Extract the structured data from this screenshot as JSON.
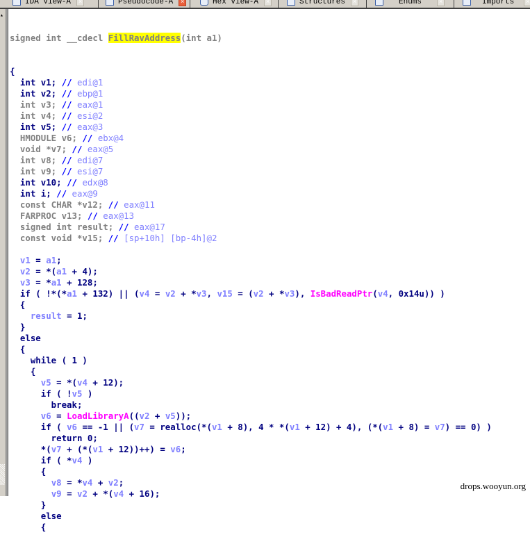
{
  "tabs": [
    {
      "label": "IDA View-A",
      "active": false
    },
    {
      "label": "Pseudocode-A",
      "active": true
    },
    {
      "label": "Hex View-A",
      "active": false
    },
    {
      "label": "Structures",
      "active": false
    },
    {
      "label": "Enums",
      "active": false
    },
    {
      "label": "Imports",
      "active": false
    }
  ],
  "code": {
    "signature": {
      "prefix": "signed int __cdecl ",
      "name": "FillRavAddress",
      "suffix": "(int a1)"
    },
    "lines": [
      [
        [
          "kw",
          "{"
        ]
      ],
      [
        [
          "kw",
          "  int v1; "
        ],
        [
          "cmk",
          "// "
        ],
        [
          "cm",
          "edi@1"
        ]
      ],
      [
        [
          "kw",
          "  int v2; "
        ],
        [
          "cmk",
          "// "
        ],
        [
          "cm",
          "ebp@1"
        ]
      ],
      [
        [
          "gray",
          "  int v3; "
        ],
        [
          "cmk",
          "// "
        ],
        [
          "cm",
          "eax@1"
        ]
      ],
      [
        [
          "gray",
          "  int v4; "
        ],
        [
          "cmk",
          "// "
        ],
        [
          "cm",
          "esi@2"
        ]
      ],
      [
        [
          "kw",
          "  int v5; "
        ],
        [
          "cmk",
          "// "
        ],
        [
          "cm",
          "eax@3"
        ]
      ],
      [
        [
          "gray",
          "  HMODULE v6; "
        ],
        [
          "cmk",
          "// "
        ],
        [
          "cm",
          "ebx@4"
        ]
      ],
      [
        [
          "gray",
          "  void *v7; "
        ],
        [
          "cmk",
          "// "
        ],
        [
          "cm",
          "eax@5"
        ]
      ],
      [
        [
          "gray",
          "  int v8; "
        ],
        [
          "cmk",
          "// "
        ],
        [
          "cm",
          "edi@7"
        ]
      ],
      [
        [
          "gray",
          "  int v9; "
        ],
        [
          "cmk",
          "// "
        ],
        [
          "cm",
          "esi@7"
        ]
      ],
      [
        [
          "kw",
          "  int v10; "
        ],
        [
          "cmk",
          "// "
        ],
        [
          "cm",
          "edx@8"
        ]
      ],
      [
        [
          "kw",
          "  int i; "
        ],
        [
          "cmk",
          "// "
        ],
        [
          "cm",
          "eax@9"
        ]
      ],
      [
        [
          "gray",
          "  const CHAR *v12; "
        ],
        [
          "cmk",
          "// "
        ],
        [
          "cm",
          "eax@11"
        ]
      ],
      [
        [
          "gray",
          "  FARPROC v13; "
        ],
        [
          "cmk",
          "// "
        ],
        [
          "cm",
          "eax@13"
        ]
      ],
      [
        [
          "gray",
          "  signed int result; "
        ],
        [
          "cmk",
          "// "
        ],
        [
          "cm",
          "eax@17"
        ]
      ],
      [
        [
          "gray",
          "  const void *v15; "
        ],
        [
          "cmk",
          "// "
        ],
        [
          "cm",
          "[sp+10h] [bp-4h]@2"
        ]
      ],
      [
        [
          "kw",
          ""
        ]
      ],
      [
        [
          "kw",
          "  "
        ],
        [
          "var",
          "v1"
        ],
        [
          "kw",
          " = "
        ],
        [
          "var",
          "a1"
        ],
        [
          "kw",
          ";"
        ]
      ],
      [
        [
          "kw",
          "  "
        ],
        [
          "var",
          "v2"
        ],
        [
          "kw",
          " = *("
        ],
        [
          "var",
          "a1"
        ],
        [
          "kw",
          " + 4);"
        ]
      ],
      [
        [
          "kw",
          "  "
        ],
        [
          "var",
          "v3"
        ],
        [
          "kw",
          " = *"
        ],
        [
          "var",
          "a1"
        ],
        [
          "kw",
          " + 128;"
        ]
      ],
      [
        [
          "kw",
          "  if ( !*(*"
        ],
        [
          "var",
          "a1"
        ],
        [
          "kw",
          " + 132) || ("
        ],
        [
          "var",
          "v4"
        ],
        [
          "kw",
          " = "
        ],
        [
          "var",
          "v2"
        ],
        [
          "kw",
          " + *"
        ],
        [
          "var",
          "v3"
        ],
        [
          "kw",
          ", "
        ],
        [
          "var",
          "v15"
        ],
        [
          "kw",
          " = ("
        ],
        [
          "var",
          "v2"
        ],
        [
          "kw",
          " + *"
        ],
        [
          "var",
          "v3"
        ],
        [
          "kw",
          "), "
        ],
        [
          "fn",
          "IsBadReadPtr"
        ],
        [
          "kw",
          "("
        ],
        [
          "var",
          "v4"
        ],
        [
          "kw",
          ", 0x14u)) )"
        ]
      ],
      [
        [
          "kw",
          "  {"
        ]
      ],
      [
        [
          "kw",
          "    "
        ],
        [
          "var",
          "result"
        ],
        [
          "kw",
          " = 1;"
        ]
      ],
      [
        [
          "kw",
          "  }"
        ]
      ],
      [
        [
          "kw",
          "  else"
        ]
      ],
      [
        [
          "kw",
          "  {"
        ]
      ],
      [
        [
          "kw",
          "    while ( 1 )"
        ]
      ],
      [
        [
          "kw",
          "    {"
        ]
      ],
      [
        [
          "kw",
          "      "
        ],
        [
          "var",
          "v5"
        ],
        [
          "kw",
          " = *("
        ],
        [
          "var",
          "v4"
        ],
        [
          "kw",
          " + 12);"
        ]
      ],
      [
        [
          "kw",
          "      if ( !"
        ],
        [
          "var",
          "v5"
        ],
        [
          "kw",
          " )"
        ]
      ],
      [
        [
          "kw",
          "        break;"
        ]
      ],
      [
        [
          "kw",
          "      "
        ],
        [
          "var",
          "v6"
        ],
        [
          "kw",
          " = "
        ],
        [
          "fn",
          "LoadLibraryA"
        ],
        [
          "kw",
          "(("
        ],
        [
          "var",
          "v2"
        ],
        [
          "kw",
          " + "
        ],
        [
          "var",
          "v5"
        ],
        [
          "kw",
          "));"
        ]
      ],
      [
        [
          "kw",
          "      if ( "
        ],
        [
          "var",
          "v6"
        ],
        [
          "kw",
          " == -1 || ("
        ],
        [
          "var",
          "v7"
        ],
        [
          "kw",
          " = realloc(*("
        ],
        [
          "var",
          "v1"
        ],
        [
          "kw",
          " + 8), 4 * *("
        ],
        [
          "var",
          "v1"
        ],
        [
          "kw",
          " + 12) + 4), (*("
        ],
        [
          "var",
          "v1"
        ],
        [
          "kw",
          " + 8) = "
        ],
        [
          "var",
          "v7"
        ],
        [
          "kw",
          ") == 0) )"
        ]
      ],
      [
        [
          "kw",
          "        return 0;"
        ]
      ],
      [
        [
          "kw",
          "      *("
        ],
        [
          "var",
          "v7"
        ],
        [
          "kw",
          " + (*("
        ],
        [
          "var",
          "v1"
        ],
        [
          "kw",
          " + 12))++) = "
        ],
        [
          "var",
          "v6"
        ],
        [
          "kw",
          ";"
        ]
      ],
      [
        [
          "kw",
          "      if ( *"
        ],
        [
          "var",
          "v4"
        ],
        [
          "kw",
          " )"
        ]
      ],
      [
        [
          "kw",
          "      {"
        ]
      ],
      [
        [
          "kw",
          "        "
        ],
        [
          "var",
          "v8"
        ],
        [
          "kw",
          " = *"
        ],
        [
          "var",
          "v4"
        ],
        [
          "kw",
          " + "
        ],
        [
          "var",
          "v2"
        ],
        [
          "kw",
          ";"
        ]
      ],
      [
        [
          "kw",
          "        "
        ],
        [
          "var",
          "v9"
        ],
        [
          "kw",
          " = "
        ],
        [
          "var",
          "v2"
        ],
        [
          "kw",
          " + *("
        ],
        [
          "var",
          "v4"
        ],
        [
          "kw",
          " + 16);"
        ]
      ],
      [
        [
          "kw",
          "      }"
        ]
      ],
      [
        [
          "kw",
          "      else"
        ]
      ],
      [
        [
          "kw",
          "      {"
        ]
      ]
    ]
  },
  "watermark": "drops.wooyun.org"
}
